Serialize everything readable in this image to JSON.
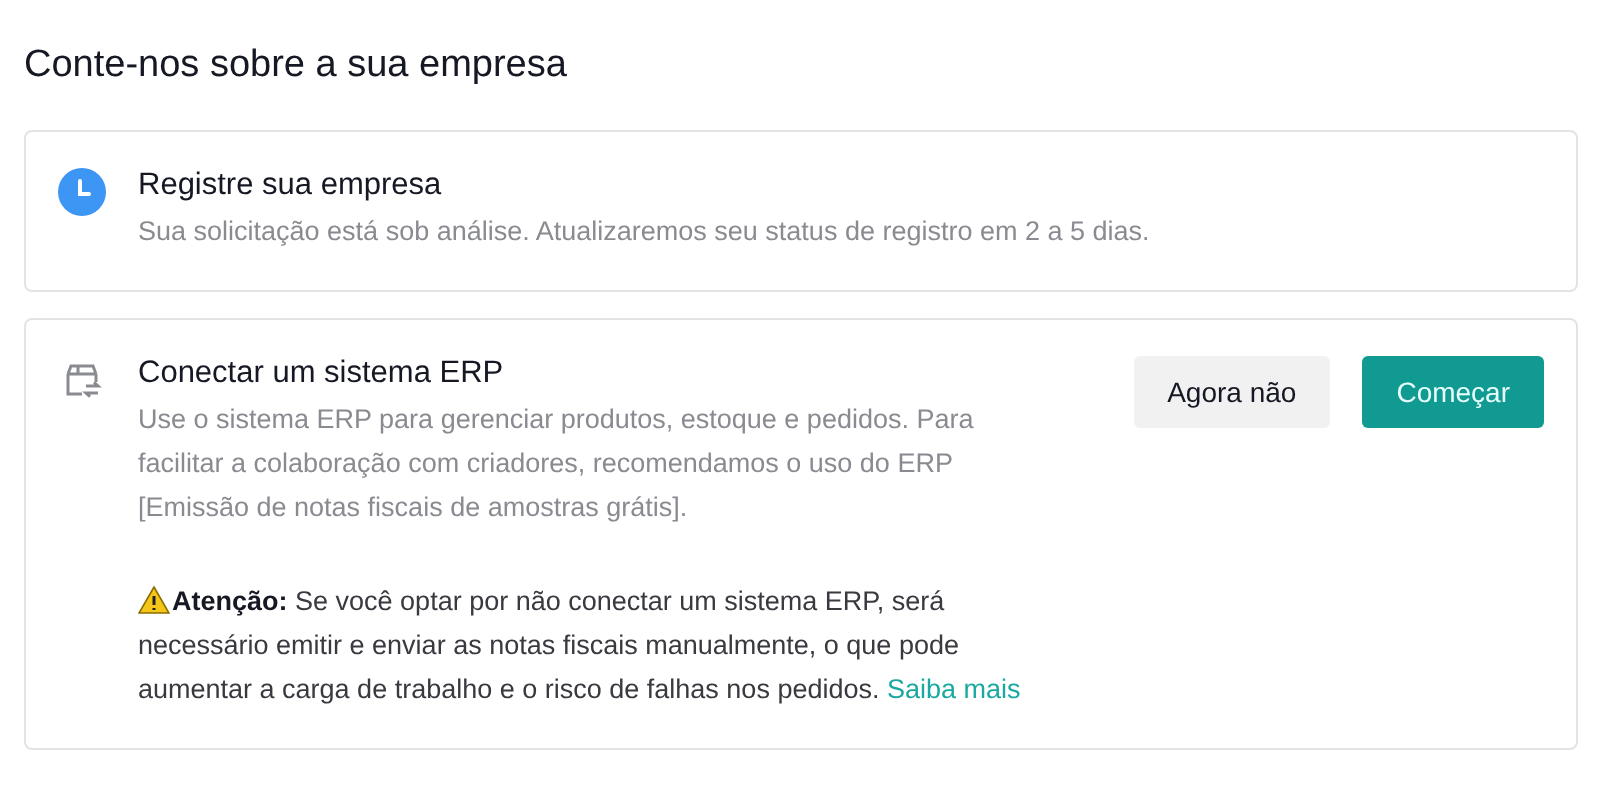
{
  "page": {
    "title": "Conte-nos sobre a sua empresa"
  },
  "cards": [
    {
      "kind": "status",
      "title": "Registre sua empresa",
      "description": [
        "Sua solicitação está sob análise. Atualizaremos seu status de registro em 2 a 5 dias."
      ]
    },
    {
      "kind": "action",
      "title": "Conectar um sistema ERP",
      "description": [
        "Use o sistema ERP para gerenciar produtos, estoque e pedidos. Para facilitar a colaboração com criadores, recomendamos o uso do ERP [Emissão de notas fiscais de amostras grátis]."
      ],
      "warning": {
        "text": "**Atenção:** Se você optar por não conectar um sistema ERP, será necessário emitir e enviar as notas fiscais manualmente, o que pode aumentar a carga de trabalho e o risco de falhas nos pedidos.",
        "link": "Saiba mais"
      },
      "buttons": [
        {
          "label": "Agora não",
          "kind": "secondary"
        },
        {
          "label": "Começar",
          "kind": "primary"
        }
      ]
    }
  ]
}
